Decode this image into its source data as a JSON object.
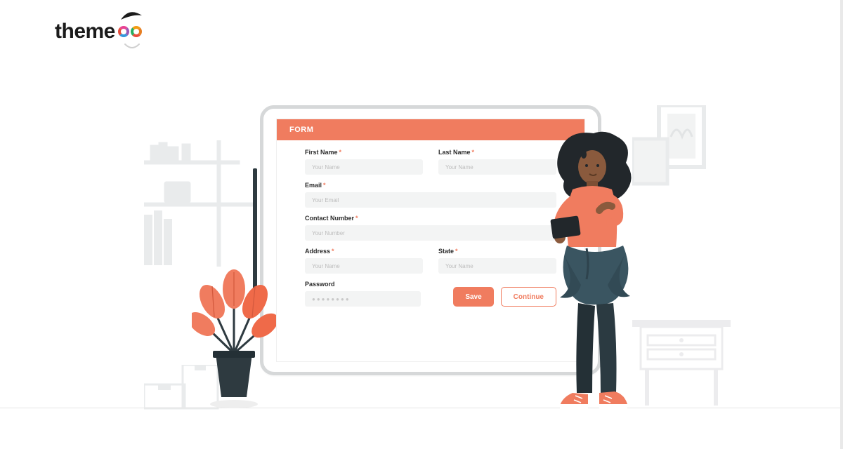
{
  "logo": {
    "text": "theme"
  },
  "form": {
    "header": "FORM",
    "fields": {
      "first_name": {
        "label": "First Name",
        "required": true,
        "placeholder": "Your Name"
      },
      "last_name": {
        "label": "Last Name",
        "required": true,
        "placeholder": "Your Name"
      },
      "email": {
        "label": "Email",
        "required": true,
        "placeholder": "Your Email"
      },
      "contact": {
        "label": "Contact  Number",
        "required": true,
        "placeholder": "Your Number"
      },
      "address": {
        "label": "Address",
        "required": true,
        "placeholder": "Your Name"
      },
      "state": {
        "label": "State",
        "required": true,
        "placeholder": "Your Name"
      },
      "password": {
        "label": "Password",
        "required": false,
        "placeholder": "●●●●●●●●"
      }
    },
    "buttons": {
      "save": "Save",
      "continue": "Continue"
    }
  },
  "decorations": {
    "plant_icon": "plant-icon",
    "person_icon": "person-icon",
    "shelf_icon": "shelf-icon",
    "frame_icon": "frame-icon",
    "desk_icon": "desk-icon"
  },
  "colors": {
    "accent": "#f07c5f",
    "input_bg": "#f3f4f4",
    "bg_gray": "#e9ebec",
    "dark": "#2e3a40"
  }
}
